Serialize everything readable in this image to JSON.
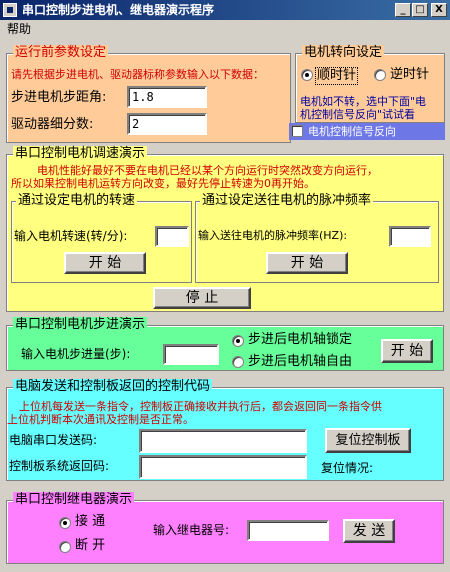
{
  "window": {
    "title": "串口控制步进电机、继电器演示程序",
    "min": "_",
    "max": "□",
    "close": "X"
  },
  "menu": {
    "help": "帮助"
  },
  "params": {
    "title": "运行前参数设定",
    "hint": "请先根据步进电机、驱动器标称参数输入以下数据：",
    "step_angle_label": "步进电机步距角:",
    "step_angle_value": "1.8",
    "subdivision_label": "驱动器细分数:",
    "subdivision_value": "2"
  },
  "direction": {
    "title": "电机转向设定",
    "cw": "顺时针",
    "ccw": "逆时针",
    "cw_selected": true,
    "note_line1": "电机如不转，选中下面\"电",
    "note_line2": "机控制信号反向\"试试看",
    "reverse_label": "电机控制信号反向",
    "reverse_checked": false
  },
  "speed": {
    "title": "串口控制电机调速演示",
    "warn_line1": "电机性能好最好不要在电机已经以某个方向运行时突然改变方向运行，",
    "warn_line2": "所以如果控制电机运转方向改变，最好先停止转速为0再开始。",
    "rpm_box_title": "通过设定电机的转速",
    "rpm_label": "输入电机转速(转/分):",
    "rpm_value": "",
    "rpm_start": "开  始",
    "freq_box_title": "通过设定送往电机的脉冲频率",
    "freq_label": "输入送往电机的脉冲频率(HZ):",
    "freq_value": "",
    "freq_start": "开  始",
    "stop": "停  止"
  },
  "stepping": {
    "title": "串口控制电机步进演示",
    "amount_label": "输入电机步进量(步):",
    "amount_value": "",
    "lock": "步进后电机轴锁定",
    "free": "步进后电机轴自由",
    "lock_selected": true,
    "start": "开 始"
  },
  "codes": {
    "title": "电脑发送和控制板返回的控制代码",
    "info_line1": "上位机每发送一条指令，控制板正确接收并执行后，都会返回同一条指令供",
    "info_line2": "上位机判断本次通讯及控制是否正常。",
    "send_label": "电脑串口发送码:",
    "send_value": "",
    "return_label": "控制板系统返回码:",
    "return_value": "",
    "reset_button": "复位控制板",
    "reset_status_label": "复位情况:"
  },
  "relay": {
    "title": "串口控制继电器演示",
    "on": "接 通",
    "off": "断 开",
    "on_selected": true,
    "number_label": "输入继电器号:",
    "number_value": "",
    "send": "发 送"
  },
  "colors": {
    "params_bg": "#ffcc99",
    "direction_bg": "#ffcc99",
    "reverse_bar": "#6e77e6",
    "speed_bg": "#ffff80",
    "stepping_bg": "#66ff99",
    "codes_bg": "#66ffff",
    "relay_bg": "#ff80ff"
  }
}
